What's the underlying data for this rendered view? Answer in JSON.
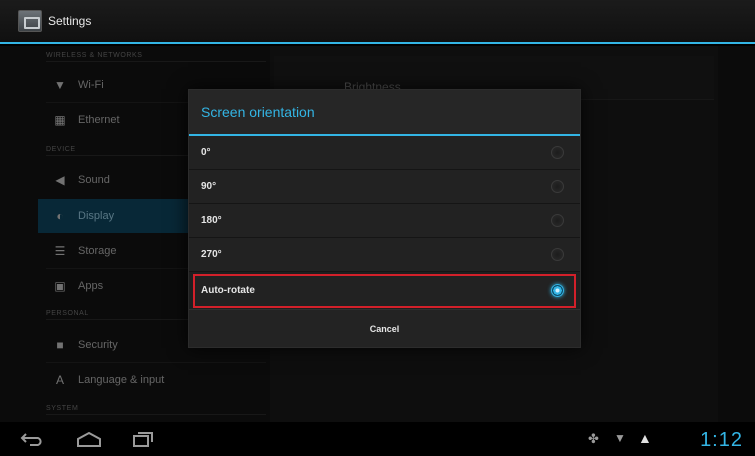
{
  "actionbar": {
    "title": "Settings",
    "icon": "settings-icon"
  },
  "sections": {
    "wireless": "WIRELESS & NETWORKS",
    "device": "DEVICE",
    "personal": "PERSONAL",
    "system": "SYSTEM"
  },
  "nav": [
    {
      "label": "Wi-Fi",
      "icon": "wifi-icon"
    },
    {
      "label": "Ethernet",
      "icon": "ethernet-icon"
    },
    {
      "label": "Sound",
      "icon": "sound-icon"
    },
    {
      "label": "Display",
      "icon": "display-icon"
    },
    {
      "label": "Storage",
      "icon": "storage-icon"
    },
    {
      "label": "Apps",
      "icon": "apps-icon"
    },
    {
      "label": "Security",
      "icon": "lock-icon"
    },
    {
      "label": "Language & input",
      "icon": "language-icon"
    }
  ],
  "selected_nav": "Display",
  "right_pane": {
    "brightness_label": "Brightness"
  },
  "dialog": {
    "title": "Screen orientation",
    "options": [
      "0°",
      "90°",
      "180°",
      "270°",
      "Auto-rotate"
    ],
    "selected": "Auto-rotate",
    "cancel_label": "Cancel"
  },
  "status": {
    "time": "1:12"
  },
  "colors": {
    "accent": "#33b5e5",
    "highlight": "#d3202a"
  }
}
